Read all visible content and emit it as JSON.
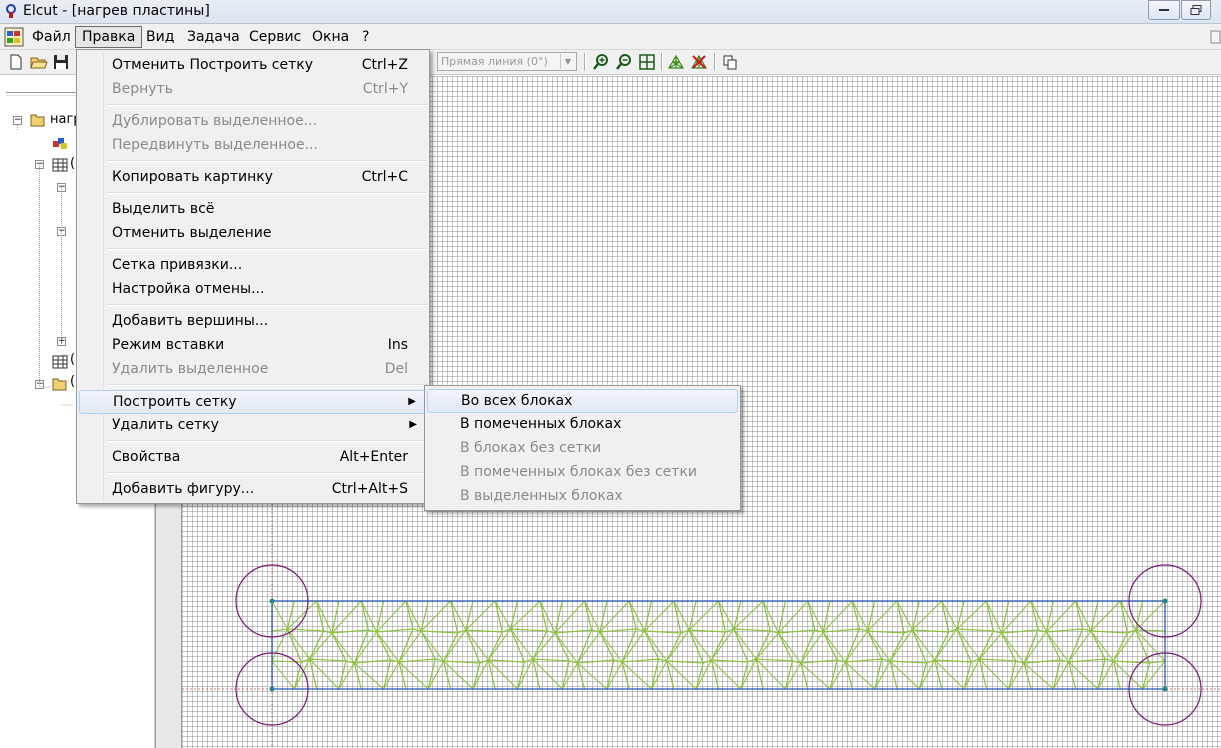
{
  "window": {
    "title": "Elcut - [нагрев пластины]"
  },
  "menubar": {
    "items": [
      "Файл",
      "Правка",
      "Вид",
      "Задача",
      "Сервис",
      "Окна",
      "?"
    ],
    "active": "Правка"
  },
  "toolbar": {
    "line_type_combo": "Прямая линия (0°)"
  },
  "tree": {
    "root_label": "нагр"
  },
  "edit_menu": {
    "items": [
      {
        "label": "Отменить Построить сетку",
        "shortcut": "Ctrl+Z",
        "enabled": true
      },
      {
        "label": "Вернуть",
        "shortcut": "Ctrl+Y",
        "enabled": false
      },
      {
        "label": "Дублировать выделенное...",
        "shortcut": "",
        "enabled": false
      },
      {
        "label": "Передвинуть выделенное...",
        "shortcut": "",
        "enabled": false
      },
      {
        "label": "Копировать картинку",
        "shortcut": "Ctrl+C",
        "enabled": true
      },
      {
        "label": "Выделить всё",
        "shortcut": "",
        "enabled": true
      },
      {
        "label": "Отменить выделение",
        "shortcut": "",
        "enabled": true
      },
      {
        "label": "Сетка привязки...",
        "shortcut": "",
        "enabled": true
      },
      {
        "label": "Настройка отмены...",
        "shortcut": "",
        "enabled": true
      },
      {
        "label": "Добавить вершины...",
        "shortcut": "",
        "enabled": true
      },
      {
        "label": "Режим вставки",
        "shortcut": "Ins",
        "enabled": true
      },
      {
        "label": "Удалить выделенное",
        "shortcut": "Del",
        "enabled": false
      },
      {
        "label": "Построить сетку",
        "shortcut": "",
        "enabled": true,
        "submenu": true
      },
      {
        "label": "Удалить сетку",
        "shortcut": "",
        "enabled": true,
        "submenu": true
      },
      {
        "label": "Свойства",
        "shortcut": "Alt+Enter",
        "enabled": true
      },
      {
        "label": "Добавить фигуру...",
        "shortcut": "Ctrl+Alt+S",
        "enabled": true
      }
    ]
  },
  "mesh_submenu": {
    "items": [
      {
        "label": "Во всех блоках",
        "enabled": true
      },
      {
        "label": "В помеченных блоках",
        "enabled": true
      },
      {
        "label": "В блоках без сетки",
        "enabled": false
      },
      {
        "label": "В помеченных блоках без сетки",
        "enabled": false
      },
      {
        "label": "В выделенных блоках",
        "enabled": false
      }
    ]
  },
  "colors": {
    "outline_blue": "#1f4fb8",
    "mesh_green": "#8bc23a",
    "circle_purple": "#7a1a7a",
    "axis_red": "#d04040",
    "node_teal": "#1a8a8a"
  }
}
